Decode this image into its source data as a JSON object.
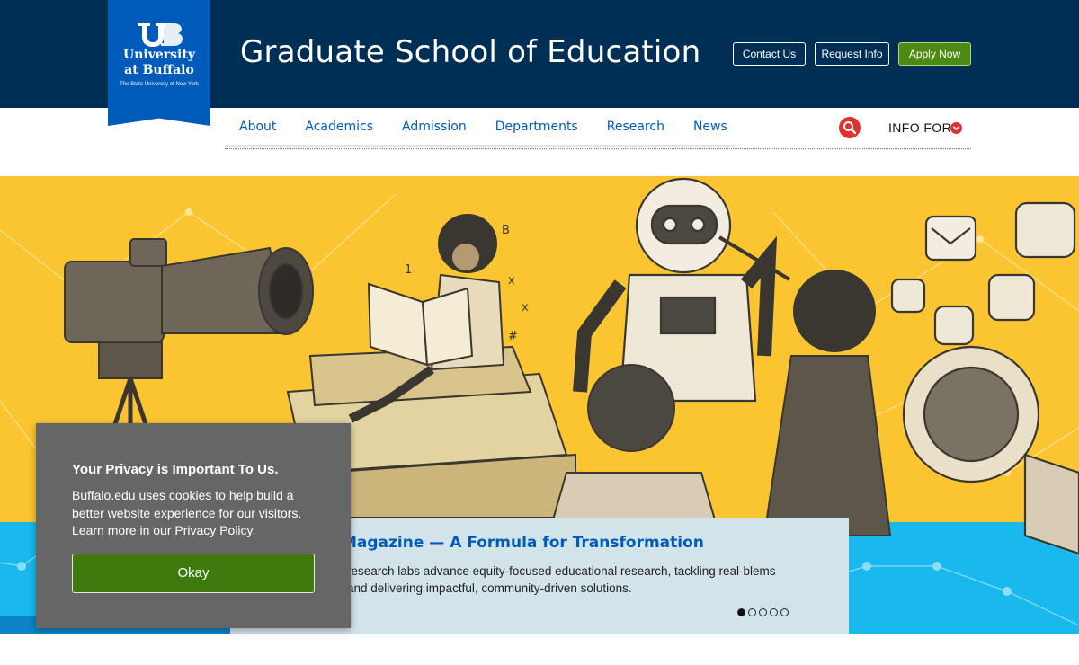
{
  "header": {
    "logo": {
      "line1": "University",
      "line2": "at Buffalo",
      "subtitle": "The State University of New York"
    },
    "site_title": "Graduate School of Education",
    "buttons": {
      "contact": "Contact Us",
      "request": "Request Info",
      "apply": "Apply Now"
    }
  },
  "nav": {
    "items": [
      "About",
      "Academics",
      "Admission",
      "Departments",
      "Research",
      "News"
    ],
    "info_for": "INFO FOR"
  },
  "hero": {
    "caption_title": "Magazine — A Formula for Transformation",
    "caption_body": "research labs advance equity-focused educational research, tackling real-blems and delivering impactful, community-driven solutions.",
    "slide_count": 5,
    "active_slide": 1
  },
  "cookie": {
    "title": "Your Privacy is Important To Us.",
    "body_before": "Buffalo.edu uses cookies to help build a better website experience for our visitors. Learn more in our ",
    "link_text": "Privacy Policy",
    "body_after": ".",
    "button": "Okay"
  },
  "colors": {
    "header_bg": "#002f56",
    "ub_blue": "#005bbb",
    "hero_yellow": "#fbc531",
    "hero_blue": "#19b9ee",
    "accent_red": "#e0312c",
    "apply_green": "#4c8a14"
  }
}
